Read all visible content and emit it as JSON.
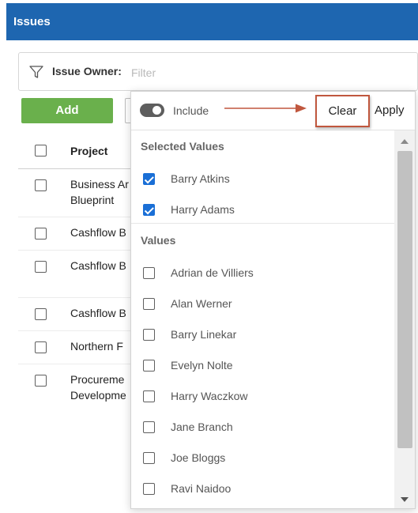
{
  "header": {
    "title": "Issues"
  },
  "filter": {
    "label": "Issue Owner:",
    "placeholder": "Filter",
    "icon": "funnel-icon"
  },
  "toolbar": {
    "add_label": "Add"
  },
  "table": {
    "column_project": "Project",
    "rows": [
      {
        "project_lines": [
          "Business Ar",
          "Blueprint"
        ]
      },
      {
        "project_lines": [
          "Cashflow B"
        ]
      },
      {
        "project_lines": [
          "Cashflow B"
        ]
      },
      {
        "project_lines": [
          "Cashflow B"
        ]
      },
      {
        "project_lines": [
          "Northern F"
        ]
      },
      {
        "project_lines": [
          "Procureme",
          "Developme"
        ]
      }
    ]
  },
  "popup": {
    "include_label": "Include",
    "include_on": true,
    "clear_label": "Clear",
    "apply_label": "Apply",
    "selected_title": "Selected Values",
    "selected": [
      {
        "label": "Barry Atkins",
        "checked": true
      },
      {
        "label": "Harry Adams",
        "checked": true
      }
    ],
    "values_title": "Values",
    "values": [
      {
        "label": "Adrian de Villiers",
        "checked": false
      },
      {
        "label": "Alan Werner",
        "checked": false
      },
      {
        "label": "Barry Linekar",
        "checked": false
      },
      {
        "label": "Evelyn Nolte",
        "checked": false
      },
      {
        "label": "Harry Waczkow",
        "checked": false
      },
      {
        "label": "Jane Branch",
        "checked": false
      },
      {
        "label": "Joe Bloggs",
        "checked": false
      },
      {
        "label": "Ravi Naidoo",
        "checked": false
      }
    ]
  },
  "colors": {
    "header_bg": "#1e66b0",
    "add_button": "#6ab04c",
    "checkbox_checked": "#1a6fd6",
    "annotation_arrow": "#c0573e"
  }
}
